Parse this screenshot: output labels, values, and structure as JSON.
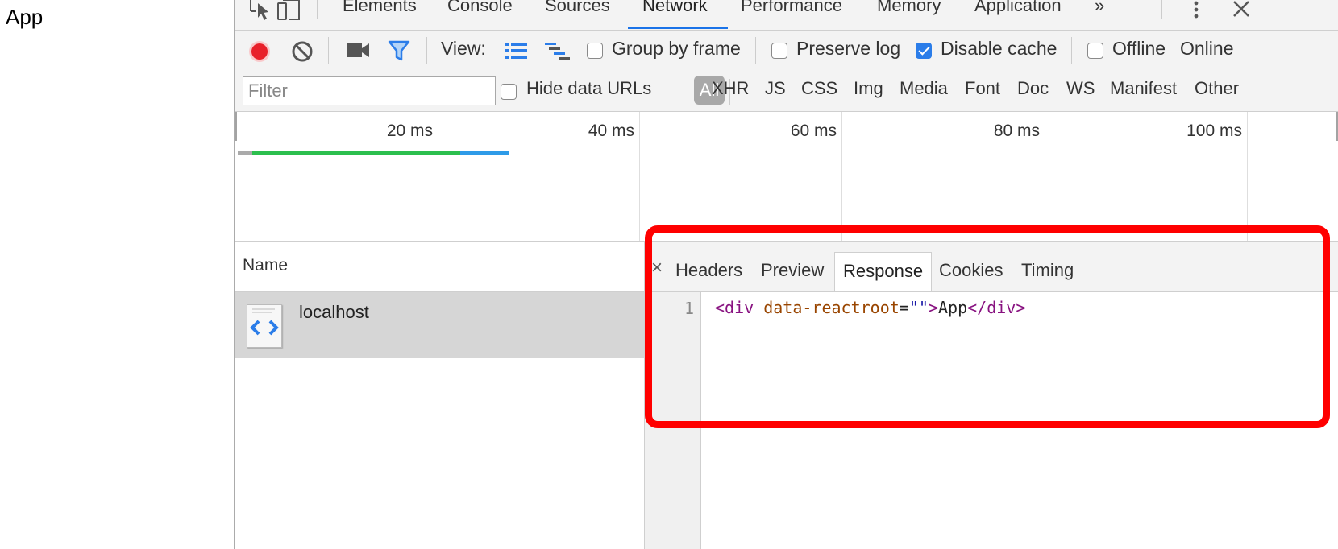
{
  "page": {
    "text": "App"
  },
  "devtools": {
    "tabs": [
      {
        "label": "Elements"
      },
      {
        "label": "Console"
      },
      {
        "label": "Sources"
      },
      {
        "label": "Network",
        "active": true
      },
      {
        "label": "Performance"
      },
      {
        "label": "Memory"
      },
      {
        "label": "Application"
      }
    ],
    "more_tabs_icon": "double-chevron-right-icon",
    "accent_color": "#1a73e8",
    "network_toolbar": {
      "record_color": "#e8202a",
      "view_label": "View:",
      "group_by_frame": {
        "label": "Group by frame",
        "checked": false
      },
      "preserve_log": {
        "label": "Preserve log",
        "checked": false
      },
      "disable_cache": {
        "label": "Disable cache",
        "checked": true
      },
      "offline": {
        "label": "Offline",
        "checked": false
      },
      "throttle": "Online"
    },
    "filter_bar": {
      "placeholder": "Filter",
      "hide_data_urls": {
        "label": "Hide data URLs",
        "checked": false
      },
      "types": [
        "All",
        "XHR",
        "JS",
        "CSS",
        "Img",
        "Media",
        "Font",
        "Doc",
        "WS",
        "Manifest",
        "Other"
      ]
    },
    "overview": {
      "ticks": [
        "20 ms",
        "40 ms",
        "60 ms",
        "80 ms",
        "100 ms"
      ],
      "bar_colors": {
        "waiting": "#2cbf4e",
        "download": "#2e9be8"
      }
    },
    "requests": {
      "column_header": "Name",
      "rows": [
        {
          "name": "localhost",
          "icon": "html-document-icon",
          "selected": true
        }
      ]
    },
    "details": {
      "tabs": [
        {
          "label": "Headers"
        },
        {
          "label": "Preview"
        },
        {
          "label": "Response",
          "active": true
        },
        {
          "label": "Cookies"
        },
        {
          "label": "Timing"
        }
      ],
      "response": {
        "line_number": "1",
        "tokens": {
          "open_tag": "<div",
          "attr_name": " data-reactroot",
          "equals": "=",
          "attr_value": "\"\"",
          "close_bracket": ">",
          "text": "App",
          "close_tag": "</div>"
        }
      }
    },
    "highlight_color": "#ff0000"
  }
}
